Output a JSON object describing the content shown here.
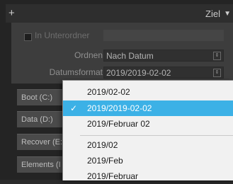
{
  "header": {
    "plus_icon": "+",
    "title": "Ziel",
    "dropdown_icon": "▼"
  },
  "panel": {
    "subfolder_checkbox_label": "In Unterordner",
    "sort_label": "Ordnen",
    "sort_value": "Nach Datum",
    "date_format_label": "Datumsformat",
    "date_format_value": "2019/2019-02-02",
    "select_icon": "⇕"
  },
  "volumes": [
    {
      "label": "Boot (C:)"
    },
    {
      "label": "Data (D:)"
    },
    {
      "label": "Recover (E:"
    },
    {
      "label": "Elements (I"
    }
  ],
  "date_format_menu": {
    "items": [
      {
        "label": "2019/02-02",
        "selected": false
      },
      {
        "label": "2019/2019-02-02",
        "selected": true
      },
      {
        "label": "2019/Februar 02",
        "selected": false
      },
      {
        "label": "2019/02",
        "selected": false
      },
      {
        "label": "2019/Feb",
        "selected": false
      },
      {
        "label": "2019/Februar",
        "selected": false
      }
    ],
    "check_icon": "✓",
    "selected_color": "#3cb1e6"
  }
}
